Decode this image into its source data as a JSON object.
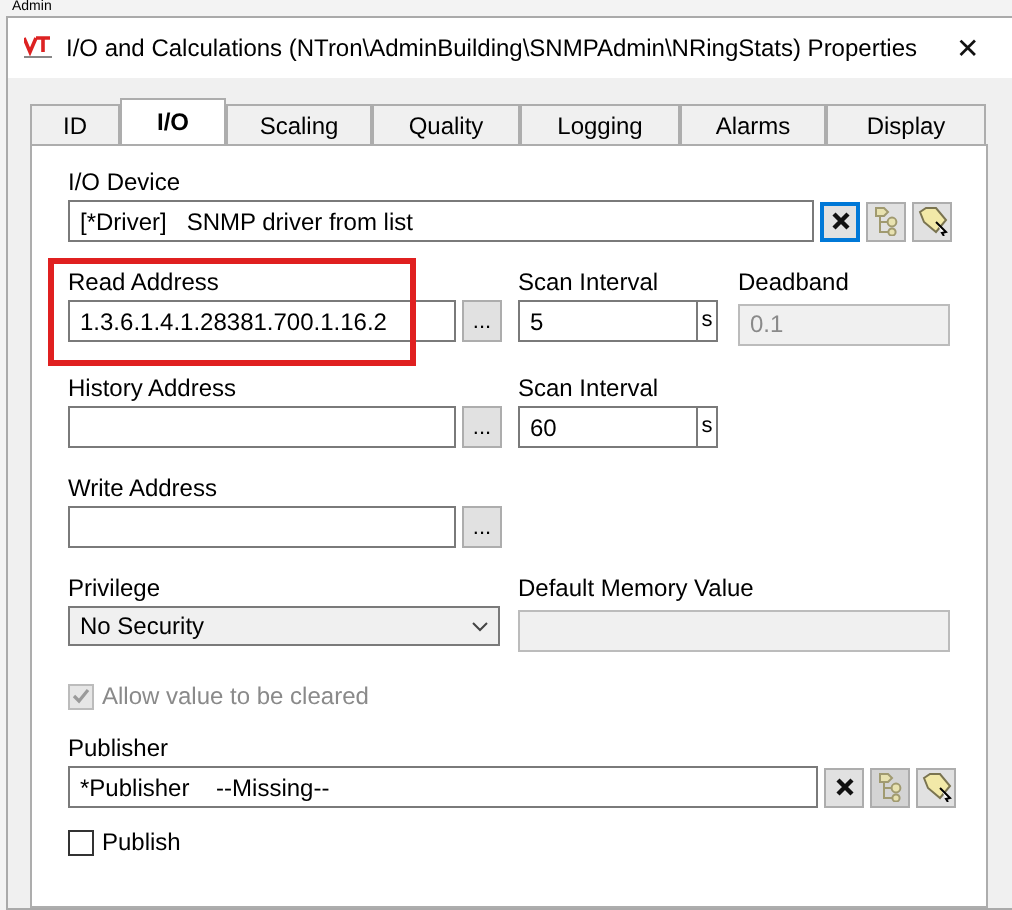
{
  "background_menu": {
    "label": "Admin"
  },
  "window": {
    "title": "I/O and Calculations (NTron\\AdminBuilding\\SNMPAdmin\\NRingStats) Properties",
    "close": "✕"
  },
  "tabs": [
    {
      "label": "ID",
      "selected": false
    },
    {
      "label": "I/O",
      "selected": true
    },
    {
      "label": "Scaling",
      "selected": false
    },
    {
      "label": "Quality",
      "selected": false
    },
    {
      "label": "Logging",
      "selected": false
    },
    {
      "label": "Alarms",
      "selected": false
    },
    {
      "label": "Display",
      "selected": false
    }
  ],
  "io_device": {
    "label": "I/O Device",
    "value": "[*Driver]   SNMP driver from list"
  },
  "read_address": {
    "label": "Read Address",
    "value": "1.3.6.1.4.1.28381.700.1.16.2",
    "browse": "...",
    "highlighted": true
  },
  "read_scan_interval": {
    "label": "Scan Interval",
    "value": "5",
    "unit": "s"
  },
  "deadband": {
    "label": "Deadband",
    "value": "0.1",
    "disabled": true
  },
  "history_address": {
    "label": "History Address",
    "browse": "..."
  },
  "history_scan_interval": {
    "label": "Scan Interval",
    "value": "60",
    "unit": "s"
  },
  "write_address": {
    "label": "Write Address",
    "browse": "..."
  },
  "privilege": {
    "label": "Privilege",
    "value": "No Security"
  },
  "default_memory_value": {
    "label": "Default Memory Value",
    "disabled": true
  },
  "allow_cleared": {
    "label": "Allow value to be cleared",
    "checked": true,
    "disabled": true
  },
  "publisher": {
    "label": "Publisher",
    "value": "*Publisher    --Missing--"
  },
  "publish": {
    "label": "Publish",
    "checked": false
  }
}
